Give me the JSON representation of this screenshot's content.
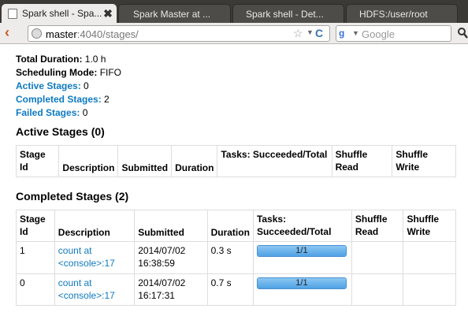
{
  "tabs": [
    {
      "title": "Spark shell - Spa...",
      "close": "✖"
    },
    {
      "title": "Spark Master at ..."
    },
    {
      "title": "Spark shell - Det..."
    },
    {
      "title": "HDFS:/user/root"
    }
  ],
  "nav": {
    "url_host": "master",
    "url_path": ":4040/stages/",
    "search_engine": "Google",
    "search_placeholder": "Google"
  },
  "summary": {
    "total_duration_label": "Total Duration:",
    "total_duration_value": "1.0 h",
    "scheduling_mode_label": "Scheduling Mode:",
    "scheduling_mode_value": "FIFO",
    "active_stages_label": "Active Stages:",
    "active_stages_value": "0",
    "completed_stages_label": "Completed Stages:",
    "completed_stages_value": "2",
    "failed_stages_label": "Failed Stages:",
    "failed_stages_value": "0"
  },
  "active_section": {
    "heading": "Active Stages (0)",
    "columns": [
      "Stage Id",
      "Description",
      "Submitted",
      "Duration",
      "Tasks: Succeeded/Total",
      "Shuffle Read",
      "Shuffle Write"
    ]
  },
  "completed_section": {
    "heading": "Completed Stages (2)",
    "columns": [
      "Stage Id",
      "Description",
      "Submitted",
      "Duration",
      "Tasks: Succeeded/Total",
      "Shuffle Read",
      "Shuffle Write"
    ],
    "rows": [
      {
        "stage_id": "1",
        "description": "count at <console>:17",
        "submitted": "2014/07/02 16:38:59",
        "duration": "0.3 s",
        "tasks": "1/1",
        "tasks_fraction": 1.0,
        "shuffle_read": "",
        "shuffle_write": ""
      },
      {
        "stage_id": "0",
        "description": "count at <console>:17",
        "submitted": "2014/07/02 16:17:31",
        "duration": "0.7 s",
        "tasks": "1/1",
        "tasks_fraction": 1.0,
        "shuffle_read": "",
        "shuffle_write": ""
      }
    ]
  }
}
